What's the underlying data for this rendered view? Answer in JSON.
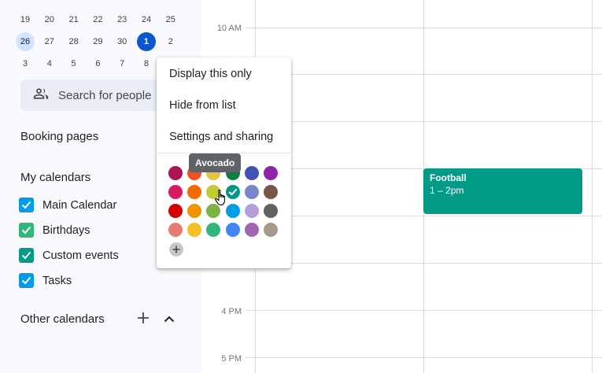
{
  "mini_calendar": {
    "rows": [
      [
        "19",
        "20",
        "21",
        "22",
        "23",
        "24",
        "25"
      ],
      [
        "26",
        "27",
        "28",
        "29",
        "30",
        "1",
        "2"
      ],
      [
        "3",
        "4",
        "5",
        "6",
        "7",
        "8",
        ""
      ]
    ],
    "today": "1",
    "week_highlight": "26"
  },
  "search": {
    "label": "Search for people",
    "icon": "people-icon"
  },
  "booking_pages": "Booking pages",
  "my_calendars": {
    "title": "My calendars",
    "items": [
      {
        "label": "Main Calendar",
        "color": "#039be5"
      },
      {
        "label": "Birthdays",
        "color": "#33b679"
      },
      {
        "label": "Custom events",
        "color": "#039b88"
      },
      {
        "label": "Tasks",
        "color": "#039be5"
      }
    ]
  },
  "other_calendars": {
    "title": "Other calendars",
    "add_icon": "plus-icon",
    "collapse_icon": "chevron-up-icon"
  },
  "grid": {
    "times": [
      "10 AM",
      "4 PM",
      "5 PM"
    ]
  },
  "event": {
    "title": "Football",
    "time": "1 – 2pm",
    "color": "#039b88"
  },
  "menu": {
    "items": [
      "Display this only",
      "Hide from list",
      "Settings and sharing"
    ],
    "tooltip": "Avocado",
    "colors": [
      [
        "#ad1457",
        "#f4511e",
        "#e4c441",
        "#0b8043",
        "#3f51b5",
        "#8e24aa"
      ],
      [
        "#d81b60",
        "#ef6c00",
        "#c0ca33",
        "#009688",
        "#7986cb",
        "#795548"
      ],
      [
        "#d50000",
        "#f09300",
        "#7cb342",
        "#039be5",
        "#b39ddb",
        "#616161"
      ],
      [
        "#e67c73",
        "#f6bf26",
        "#33b679",
        "#4285f4",
        "#9e69af",
        "#a79b8e"
      ]
    ],
    "selected_color": "#009688"
  }
}
